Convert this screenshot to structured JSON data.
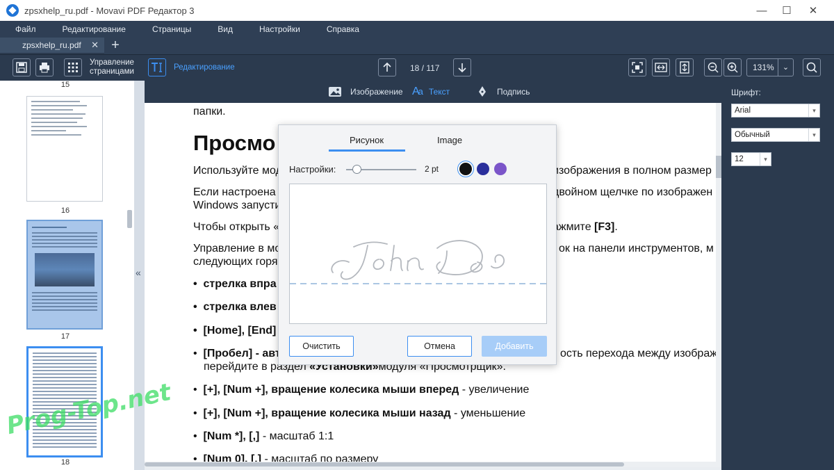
{
  "window": {
    "title": "zpsxhelp_ru.pdf - Movavi PDF Редактор 3",
    "minimize": "—",
    "maximize": "☐",
    "close": "✕"
  },
  "menu": [
    "Файл",
    "Редактирование",
    "Страницы",
    "Вид",
    "Настройки",
    "Справка"
  ],
  "tab": {
    "label": "zpsxhelp_ru.pdf",
    "close": "✕",
    "new": "+"
  },
  "toolbar": {
    "manage_pages_line1": "Управление",
    "manage_pages_line2": "страницами",
    "edit_label": "Редактирование",
    "page_current": "18",
    "page_total": "117",
    "page_text": "18 / 117",
    "zoom": "131%"
  },
  "subtoolbar": {
    "image": "Изображение",
    "text": "Текст",
    "sign": "Подпись"
  },
  "thumbnails": {
    "pages": [
      "15",
      "16",
      "17",
      "18"
    ]
  },
  "document": {
    "line_top": "папки.",
    "heading": "Просмо",
    "p1": "Используйте мод",
    "p1_right": "изображения в полном размер",
    "p2": "Если настроена",
    "p2_right": "двойном щелчке по изображен",
    "p2b": "Windows запусти",
    "p3": "Чтобы открыть «",
    "p3_right": "ажмите ",
    "p3_key": "[F3]",
    "p3_end": ".",
    "p4": "Управление в мо",
    "p4_right": "ок на панели инструментов, м",
    "p4b": "следующих горя",
    "b1": "стрелка впра",
    "b2": "стрелка влев",
    "b3": "[Home], [End]",
    "b4": "[Пробел] - авт",
    "b4_right": "ость перехода между изображ",
    "b4b_pre": "перейдите в раздел ",
    "b4b_bold": "«Установки»",
    "b4b_post": "модуля «Просмотрщик».",
    "b5_bold": "[+], [Num +], вращение колесика мыши вперед",
    "b5_rest": " - увеличение",
    "b6_bold": "[+], [Num +], вращение колесика мыши назад",
    "b6_rest": " - уменьшение",
    "b7_bold": "[Num *], [,]",
    "b7_rest": " - масштаб 1:1",
    "b8_bold": "[Num 0], [.]",
    "b8_rest": " - масштаб по размеру"
  },
  "right_panel": {
    "font_label": "Шрифт:",
    "font": "Arial",
    "style": "Обычный",
    "size": "12"
  },
  "dialog": {
    "tab_draw": "Рисунок",
    "tab_image": "Image",
    "settings_label": "Настройки:",
    "stroke_width": "2 pt",
    "stroke_value": 0.15,
    "colors": [
      "#111111",
      "#2a2f9c",
      "#7b55c9"
    ],
    "selected_color": 0,
    "signature": "John Doe",
    "clear": "Очистить",
    "cancel": "Отмена",
    "add": "Добавить"
  },
  "watermark": "Prog-Top.net"
}
